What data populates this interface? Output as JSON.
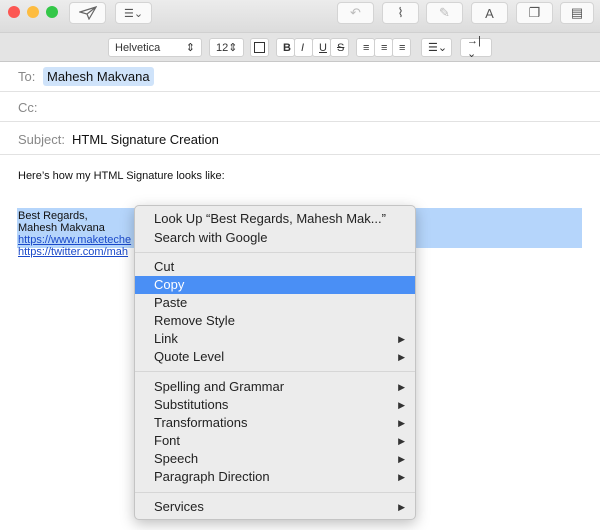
{
  "toolbar": {
    "colors": {
      "close": "#fc5753",
      "minimize": "#fdbc40",
      "zoom": "#33c748"
    },
    "icons": [
      "send-icon",
      "list-icon",
      "reply-icon",
      "attachment-icon",
      "markup-icon",
      "font-icon",
      "window-icon",
      "photo-browser-icon"
    ],
    "font_button": "A"
  },
  "format": {
    "font": "Helvetica",
    "size": "12",
    "bold": "B",
    "italic": "I",
    "underline": "U",
    "strike": "S"
  },
  "header": {
    "to_label": "To:",
    "to_value": "Mahesh Makvana",
    "cc_label": "Cc:",
    "subject_label": "Subject:",
    "subject_value": "HTML Signature Creation"
  },
  "body": {
    "intro": "Here’s how my HTML Signature looks like:",
    "line1": "Best Regards,",
    "line2": "Mahesh Makvana",
    "link1": "https://www.maketeche",
    "link2": "https://twitter.com/mah"
  },
  "menu": {
    "items": [
      {
        "label": "Look Up “Best Regards, Mahesh Mak...”"
      },
      {
        "label": "Search with Google"
      },
      {
        "label": "Cut"
      },
      {
        "label": "Copy",
        "highlighted": true
      },
      {
        "label": "Paste"
      },
      {
        "label": "Remove Style"
      },
      {
        "label": "Link",
        "submenu": true
      },
      {
        "label": "Quote Level",
        "submenu": true
      },
      {
        "label": "Spelling and Grammar",
        "submenu": true
      },
      {
        "label": "Substitutions",
        "submenu": true
      },
      {
        "label": "Transformations",
        "submenu": true
      },
      {
        "label": "Font",
        "submenu": true
      },
      {
        "label": "Speech",
        "submenu": true
      },
      {
        "label": "Paragraph Direction",
        "submenu": true
      },
      {
        "label": "Services",
        "submenu": true
      }
    ],
    "arrow": "▶"
  }
}
